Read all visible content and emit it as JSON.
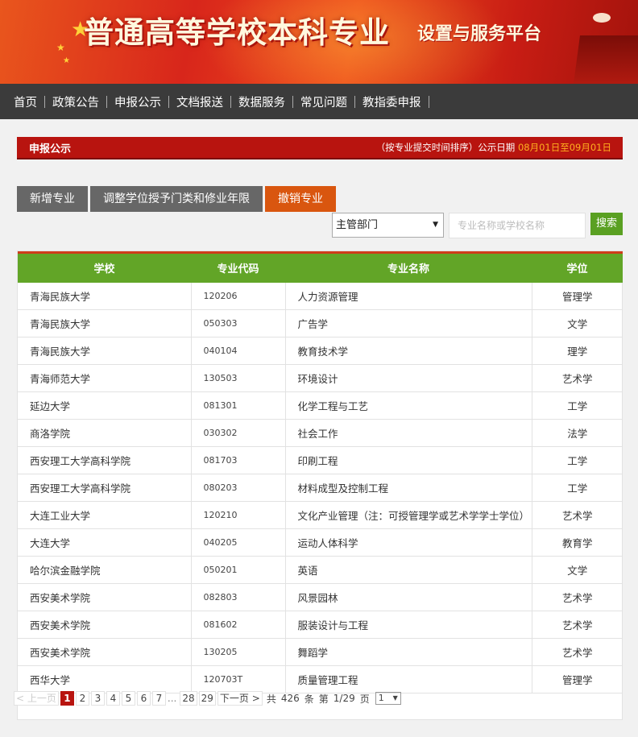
{
  "banner": {
    "title": "普通高等学校本科专业",
    "subtitle": "设置与服务平台"
  },
  "nav": {
    "items": [
      "首页",
      "政策公告",
      "申报公示",
      "文档报送",
      "数据服务",
      "常见问题",
      "教指委申报"
    ]
  },
  "section": {
    "title": "申报公示",
    "note": "（按专业提交时间排序）公示日期",
    "date_range": "08月01日至09月01日"
  },
  "tabs": [
    {
      "label": "新增专业",
      "active": false
    },
    {
      "label": "调整学位授予门类和修业年限",
      "active": false
    },
    {
      "label": "撤销专业",
      "active": true
    }
  ],
  "filters": {
    "department_select": "主管部门",
    "search_placeholder": "专业名称或学校名称",
    "search_button": "搜索"
  },
  "table": {
    "columns": [
      "学校",
      "专业代码",
      "专业名称",
      "学位"
    ],
    "rows": [
      [
        "青海民族大学",
        "120206",
        "人力资源管理",
        "管理学"
      ],
      [
        "青海民族大学",
        "050303",
        "广告学",
        "文学"
      ],
      [
        "青海民族大学",
        "040104",
        "教育技术学",
        "理学"
      ],
      [
        "青海师范大学",
        "130503",
        "环境设计",
        "艺术学"
      ],
      [
        "延边大学",
        "081301",
        "化学工程与工艺",
        "工学"
      ],
      [
        "商洛学院",
        "030302",
        "社会工作",
        "法学"
      ],
      [
        "西安理工大学高科学院",
        "081703",
        "印刷工程",
        "工学"
      ],
      [
        "西安理工大学高科学院",
        "080203",
        "材料成型及控制工程",
        "工学"
      ],
      [
        "大连工业大学",
        "120210",
        "文化产业管理（注：可授管理学或艺术学学士学位）",
        "艺术学"
      ],
      [
        "大连大学",
        "040205",
        "运动人体科学",
        "教育学"
      ],
      [
        "哈尔滨金融学院",
        "050201",
        "英语",
        "文学"
      ],
      [
        "西安美术学院",
        "082803",
        "风景园林",
        "艺术学"
      ],
      [
        "西安美术学院",
        "081602",
        "服装设计与工程",
        "艺术学"
      ],
      [
        "西安美术学院",
        "130205",
        "舞蹈学",
        "艺术学"
      ],
      [
        "西华大学",
        "120703T",
        "质量管理工程",
        "管理学"
      ]
    ]
  },
  "pager": {
    "prev": "上一页",
    "pages": [
      "1",
      "2",
      "3",
      "4",
      "5",
      "6",
      "7"
    ],
    "ellipsis": "...",
    "last_pages": [
      "28",
      "29"
    ],
    "next": "下一页",
    "total_prefix": "共",
    "total": "426",
    "total_suffix": "条",
    "page_prefix": "第",
    "current_page": "1/29",
    "page_suffix": "页",
    "page_select": "1"
  }
}
